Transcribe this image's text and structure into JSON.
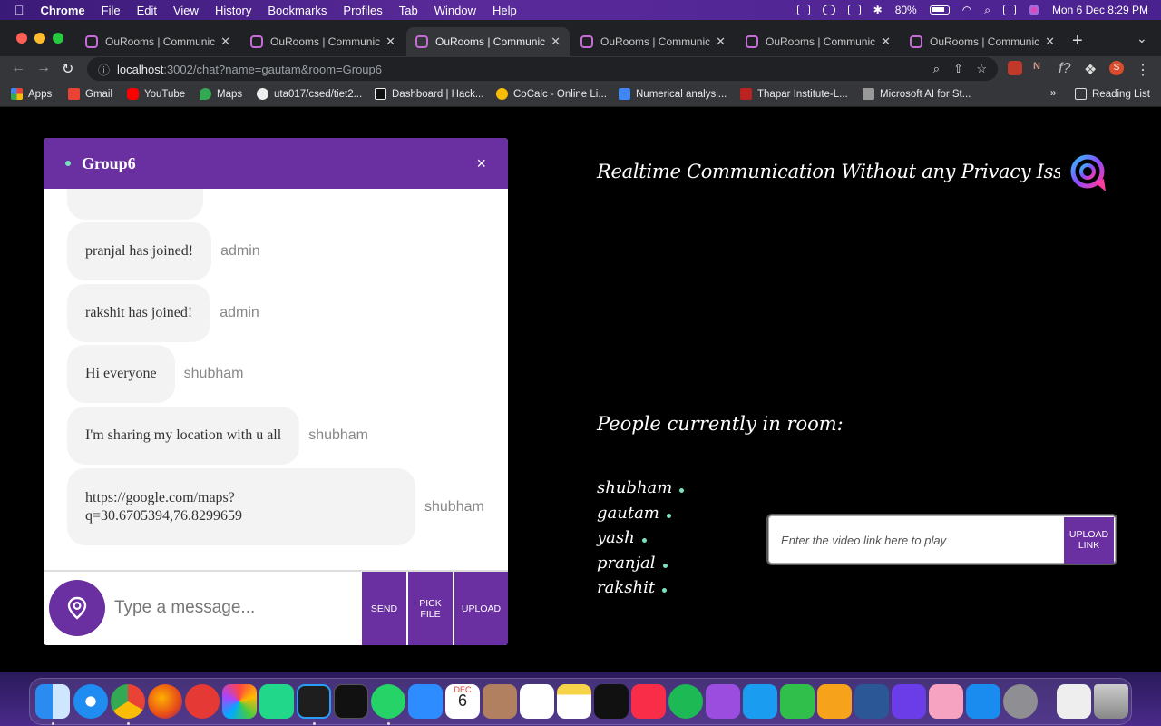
{
  "menubar": {
    "app": "Chrome",
    "items": [
      "File",
      "Edit",
      "View",
      "History",
      "Bookmarks",
      "Profiles",
      "Tab",
      "Window",
      "Help"
    ],
    "battery": "80%",
    "datetime": "Mon 6 Dec  8:29 PM"
  },
  "tabs": [
    {
      "title": "OuRooms | Communicati"
    },
    {
      "title": "OuRooms | Communicati"
    },
    {
      "title": "OuRooms | Communicati"
    },
    {
      "title": "OuRooms | Communicati"
    },
    {
      "title": "OuRooms | Communicati"
    },
    {
      "title": "OuRooms | Communicati"
    }
  ],
  "address": {
    "host": "localhost",
    "path": ":3002/chat?name=gautam&room=Group6"
  },
  "bookmarks": [
    "Apps",
    "Gmail",
    "YouTube",
    "Maps",
    "uta017/csed/tiet2...",
    "Dashboard | Hack...",
    "CoCalc - Online Li...",
    "Numerical analysi...",
    "Thapar Institute-L...",
    "Microsoft AI for St...",
    "Reading List"
  ],
  "chat": {
    "room": "Group6",
    "close": "×",
    "messages": [
      {
        "text": "pranjal has joined!",
        "sender": "admin"
      },
      {
        "text": "rakshit has joined!",
        "sender": "admin"
      },
      {
        "text": "Hi everyone",
        "sender": "shubham"
      },
      {
        "text": "I'm sharing my location with u all",
        "sender": "shubham"
      },
      {
        "text": "https://google.com/maps?\nq=30.6705394,76.8299659",
        "sender": "shubham"
      }
    ],
    "input_placeholder": "Type a message...",
    "buttons": {
      "send": "SEND",
      "pick_file": "PICK FILE",
      "upload": "UPLOAD"
    }
  },
  "right": {
    "headline": "Realtime Communication Without any Privacy Issues",
    "people_title": "People currently in room:",
    "people": [
      "shubham",
      "gautam",
      "yash",
      "pranjal",
      "rakshit"
    ],
    "video_placeholder": "Enter the video link here to play",
    "upload_link": "UPLOAD LINK"
  },
  "dock": {
    "calendar_month": "DEC",
    "calendar_day": "6"
  },
  "colors": {
    "brand": "#6a2fa0",
    "online": "#7ce0c0"
  }
}
